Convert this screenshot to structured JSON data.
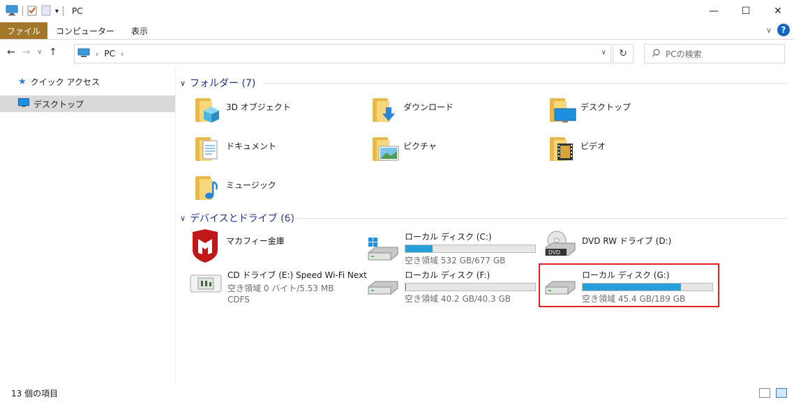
{
  "window": {
    "title": "PC"
  },
  "ribbon": {
    "tabs": [
      "ファイル",
      "コンピューター",
      "表示"
    ]
  },
  "address": {
    "path": "PC"
  },
  "search": {
    "placeholder": "PCの検索"
  },
  "sidebar": {
    "items": [
      {
        "label": "クイック アクセス",
        "icon": "star-icon"
      },
      {
        "label": "デスクトップ",
        "icon": "desktop-icon",
        "selected": true
      }
    ]
  },
  "folders": {
    "header": "フォルダー (7)",
    "items": [
      {
        "label": "3D オブジェクト",
        "icon": "3d-objects-icon"
      },
      {
        "label": "ダウンロード",
        "icon": "downloads-icon"
      },
      {
        "label": "デスクトップ",
        "icon": "desktop-folder-icon"
      },
      {
        "label": "ドキュメント",
        "icon": "documents-icon"
      },
      {
        "label": "ピクチャ",
        "icon": "pictures-icon"
      },
      {
        "label": "ビデオ",
        "icon": "videos-icon"
      },
      {
        "label": "ミュージック",
        "icon": "music-icon"
      }
    ]
  },
  "devices": {
    "header": "デバイスとドライブ (6)",
    "items": [
      {
        "label": "マカフィー金庫",
        "icon": "mcafee-icon"
      },
      {
        "label": "ローカル ディスク (C:)",
        "free": "空き領域 532 GB/677 GB",
        "usage": 0.21,
        "icon": "windows-drive-icon"
      },
      {
        "label": "DVD RW ドライブ (D:)",
        "icon": "dvd-drive-icon"
      },
      {
        "label": "CD ドライブ (E:) Speed Wi-Fi Next",
        "free": "空き領域 0 バイト/5.53 MB",
        "fs": "CDFS",
        "icon": "wifi-router-icon"
      },
      {
        "label": "ローカル ディスク (F:)",
        "free": "空き領域 40.2 GB/40.3 GB",
        "usage": 0.003,
        "icon": "hdd-icon"
      },
      {
        "label": "ローカル ディスク (G:)",
        "free": "空き領域 45.4 GB/189 GB",
        "usage": 0.76,
        "icon": "hdd-icon"
      }
    ]
  },
  "status": {
    "count": "13 個の項目"
  },
  "colors": {
    "file_tab": "#a2772a",
    "bar_fill": "#26a0da",
    "highlight": "#e02020",
    "group_header": "#1e3287"
  }
}
